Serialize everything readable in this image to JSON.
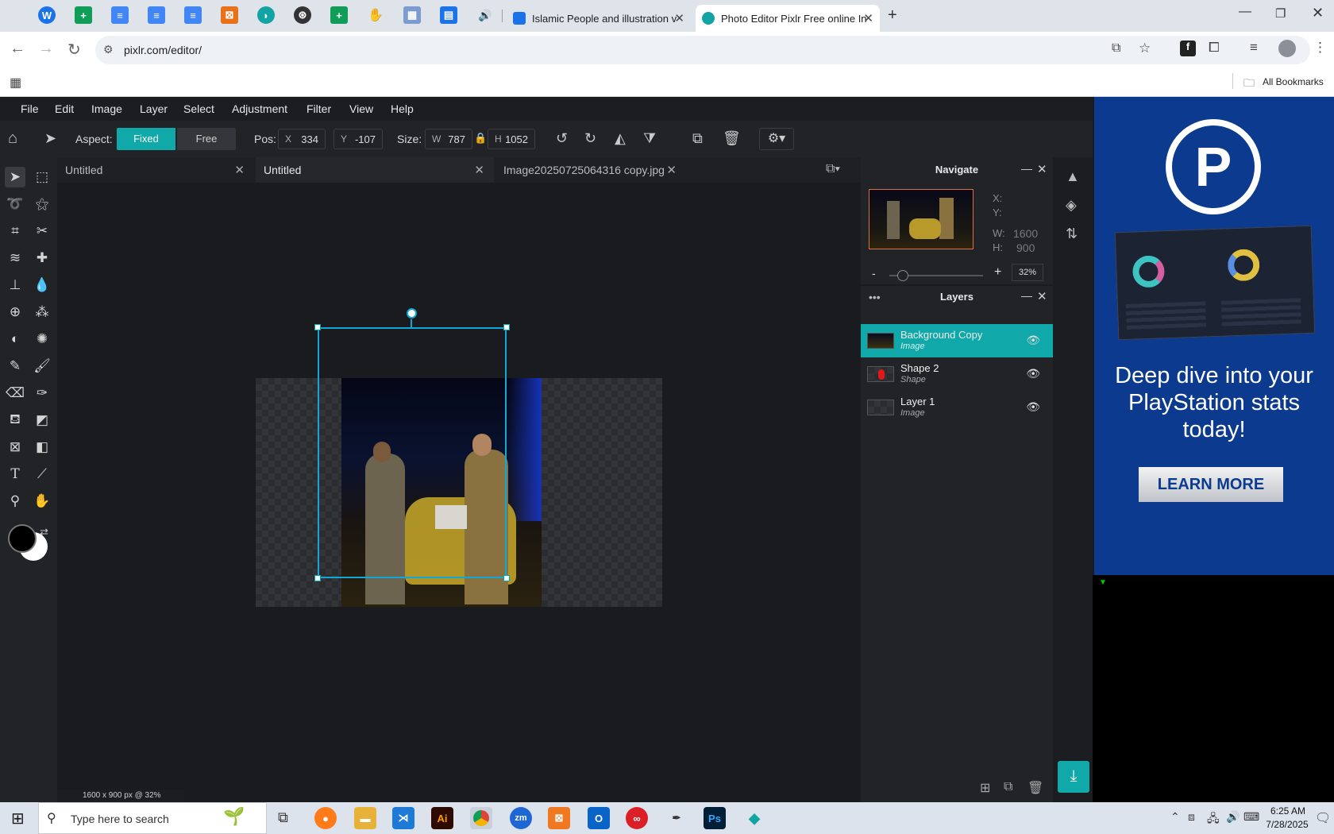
{
  "browser": {
    "tabs": [
      {
        "title": "Islamic People and illustration v",
        "active": false
      },
      {
        "title": "Photo Editor Pixlr Free online In",
        "active": true
      }
    ],
    "new_tab": "+",
    "url": "pixlr.com/editor/",
    "all_bookmarks": "All Bookmarks"
  },
  "menubar": [
    "File",
    "Edit",
    "Image",
    "Layer",
    "Select",
    "Adjustment",
    "Filter",
    "View",
    "Help"
  ],
  "tool_options": {
    "aspect_label": "Aspect:",
    "fixed": "Fixed",
    "free": "Free",
    "pos_label": "Pos:",
    "x_label": "X",
    "x_value": "334",
    "y_label": "Y",
    "y_value": "-107",
    "size_label": "Size:",
    "w_label": "W",
    "w_value": "787",
    "h_label": "H",
    "h_value": "1052"
  },
  "doc_tabs": [
    {
      "title": "Untitled",
      "active": false
    },
    {
      "title": "Untitled",
      "active": true
    },
    {
      "title": "Image20250725064316 copy.jpg",
      "active": false
    }
  ],
  "status": "1600 x 900 px @ 32%",
  "navigate": {
    "title": "Navigate",
    "x_label": "X:",
    "y_label": "Y:",
    "w_label": "W:",
    "w_value": "1600",
    "h_label": "H:",
    "h_value": "900",
    "zoom": "32%",
    "zoom_minus": "-",
    "zoom_plus": "+",
    "zoom_level": 0.1
  },
  "layers": {
    "title": "Layers",
    "items": [
      {
        "name": "Background Copy",
        "type": "Image",
        "active": true
      },
      {
        "name": "Shape 2",
        "type": "Shape",
        "active": false
      },
      {
        "name": "Layer 1",
        "type": "Image",
        "active": false
      }
    ]
  },
  "ad": {
    "headline": "Deep dive into your PlayStation stats today!",
    "cta": "LEARN MORE",
    "logo_letter": "P"
  },
  "taskbar": {
    "search_placeholder": "Type here to search",
    "time": "6:25 AM",
    "date": "7/28/2025"
  },
  "colors": {
    "accent": "#10a8a8",
    "app_bg": "#1a1b1e",
    "ad_bg": "#0b3a8e"
  }
}
